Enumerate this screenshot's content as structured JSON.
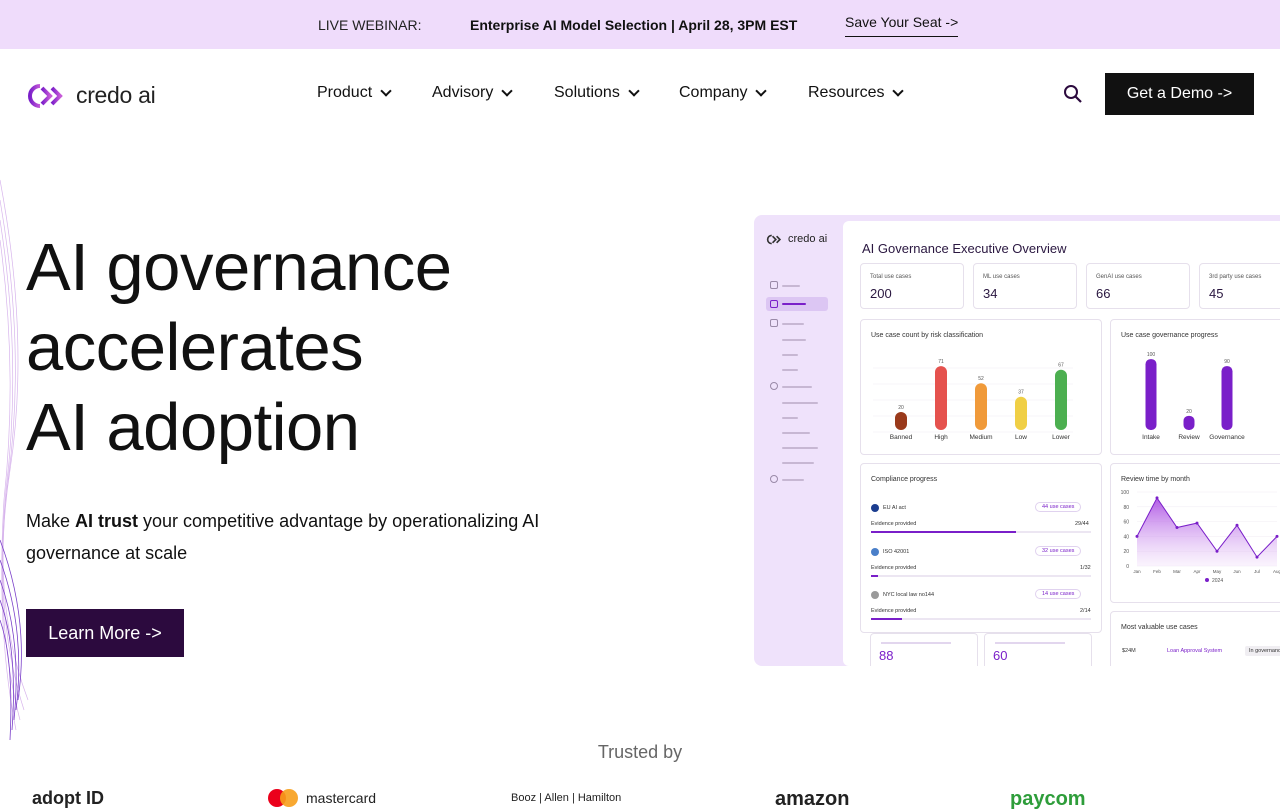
{
  "banner": {
    "label": "LIVE WEBINAR:",
    "event": "Enterprise AI Model Selection | April 28, 3PM EST",
    "cta": "Save Your Seat ->"
  },
  "nav": {
    "brand": "credo ai",
    "items": [
      "Product",
      "Advisory",
      "Solutions",
      "Company",
      "Resources"
    ],
    "demo_label": "Get a Demo ->"
  },
  "hero": {
    "title_lines": [
      "AI governance",
      "accelerates",
      "AI adoption"
    ],
    "sub_before": "Make ",
    "sub_bold": "AI trust",
    "sub_after": " your competitive advantage by operationalizing AI governance at scale",
    "cta": "Learn More ->"
  },
  "dashboard": {
    "brand": "credo ai",
    "title": "AI Governance Executive Overview",
    "kpis": [
      {
        "label": "Total use cases",
        "value": "200"
      },
      {
        "label": "ML use cases",
        "value": "34"
      },
      {
        "label": "GenAI use cases",
        "value": "66"
      },
      {
        "label": "3rd party use cases",
        "value": "45"
      }
    ],
    "risk_card_title": "Use case count by risk classification",
    "progress_card_title": "Use case governance progress",
    "compliance_title": "Compliance progress",
    "compliance": [
      {
        "name": "EU AI act",
        "pill": "44 use cases",
        "evidence_label": "Evidence provided",
        "evidence": "29/44",
        "fraction": 0.66
      },
      {
        "name": "ISO 42001",
        "pill": "32 use cases",
        "evidence_label": "Evidence provided",
        "evidence": "1/32",
        "fraction": 0.03
      },
      {
        "name": "NYC local law no144",
        "pill": "14 use cases",
        "evidence_label": "Evidence provided",
        "evidence": "2/14",
        "fraction": 0.14
      }
    ],
    "review_title": "Review time by month",
    "review_legend": "2024",
    "valuable_title": "Most valuable use cases",
    "valuable_row": {
      "value": "$24M",
      "name": "Loan Approval System",
      "status": "In governance"
    },
    "bottom_kpis": [
      "88",
      "60"
    ],
    "colors": {
      "accent": "#7a1fc9",
      "banned": "#9a3a1b",
      "high": "#e5524e",
      "medium": "#f09a3a",
      "low": "#f0cf45",
      "lower": "#4caf50"
    }
  },
  "chart_data": [
    {
      "type": "bar",
      "title": "Use case count by risk classification",
      "categories": [
        "Banned",
        "High",
        "Medium",
        "Low",
        "Lower"
      ],
      "values": [
        20,
        71,
        52,
        37,
        67
      ],
      "ylim": [
        0,
        80
      ]
    },
    {
      "type": "bar",
      "title": "Use case governance progress",
      "categories": [
        "Intake",
        "Review",
        "Governance"
      ],
      "values": [
        100,
        20,
        90
      ],
      "ylim": [
        0,
        110
      ]
    },
    {
      "type": "area",
      "title": "Review time by month",
      "x": [
        "Jan",
        "Feb",
        "Mar",
        "Apr",
        "May",
        "Jun",
        "Jul",
        "Aug"
      ],
      "series": [
        {
          "name": "2024",
          "values": [
            40,
            92,
            52,
            58,
            20,
            55,
            12,
            40
          ]
        }
      ],
      "yticks": [
        "100",
        "80",
        "60",
        "40",
        "20",
        "0"
      ],
      "ylim": [
        0,
        100
      ]
    }
  ],
  "trusted": {
    "label": "Trusted by",
    "logos": [
      "adopt ID",
      "mastercard",
      "Booz | Allen | Hamilton",
      "amazon",
      "paycom"
    ]
  }
}
